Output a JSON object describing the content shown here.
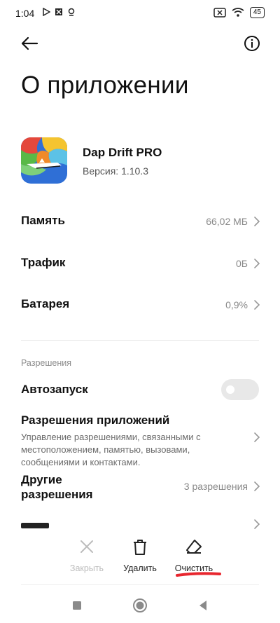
{
  "status_bar": {
    "time": "1:04",
    "battery": "45"
  },
  "header": {
    "back_icon": "arrow-left-icon",
    "info_icon": "info-circle-icon"
  },
  "page": {
    "title": "О приложении"
  },
  "app": {
    "name": "Dap Drift PRO",
    "version": "Версия: 1.10.3"
  },
  "stats": [
    {
      "label": "Память",
      "value": "66,02 МБ"
    },
    {
      "label": "Трафик",
      "value": "0Б"
    },
    {
      "label": "Батарея",
      "value": "0,9%"
    }
  ],
  "permissions": {
    "section_title": "Разрешения",
    "autostart_label": "Автозапуск",
    "autostart_enabled": false,
    "app_permissions_title": "Разрешения приложений",
    "app_permissions_desc": "Управление разрешениями, связанными с местоположением, памятью, вызовами, сообщениями и контактами.",
    "other_permissions_title_line1": "Другие",
    "other_permissions_title_line2": "разрешения",
    "other_permissions_value": "3 разрешения"
  },
  "actions": {
    "close": "Закрыть",
    "uninstall": "Удалить",
    "clear": "Очистить"
  },
  "colors": {
    "accent_underline": "#e8262e",
    "toggle_off": "#e8e8e8",
    "disabled_text": "#bcbcbc"
  }
}
